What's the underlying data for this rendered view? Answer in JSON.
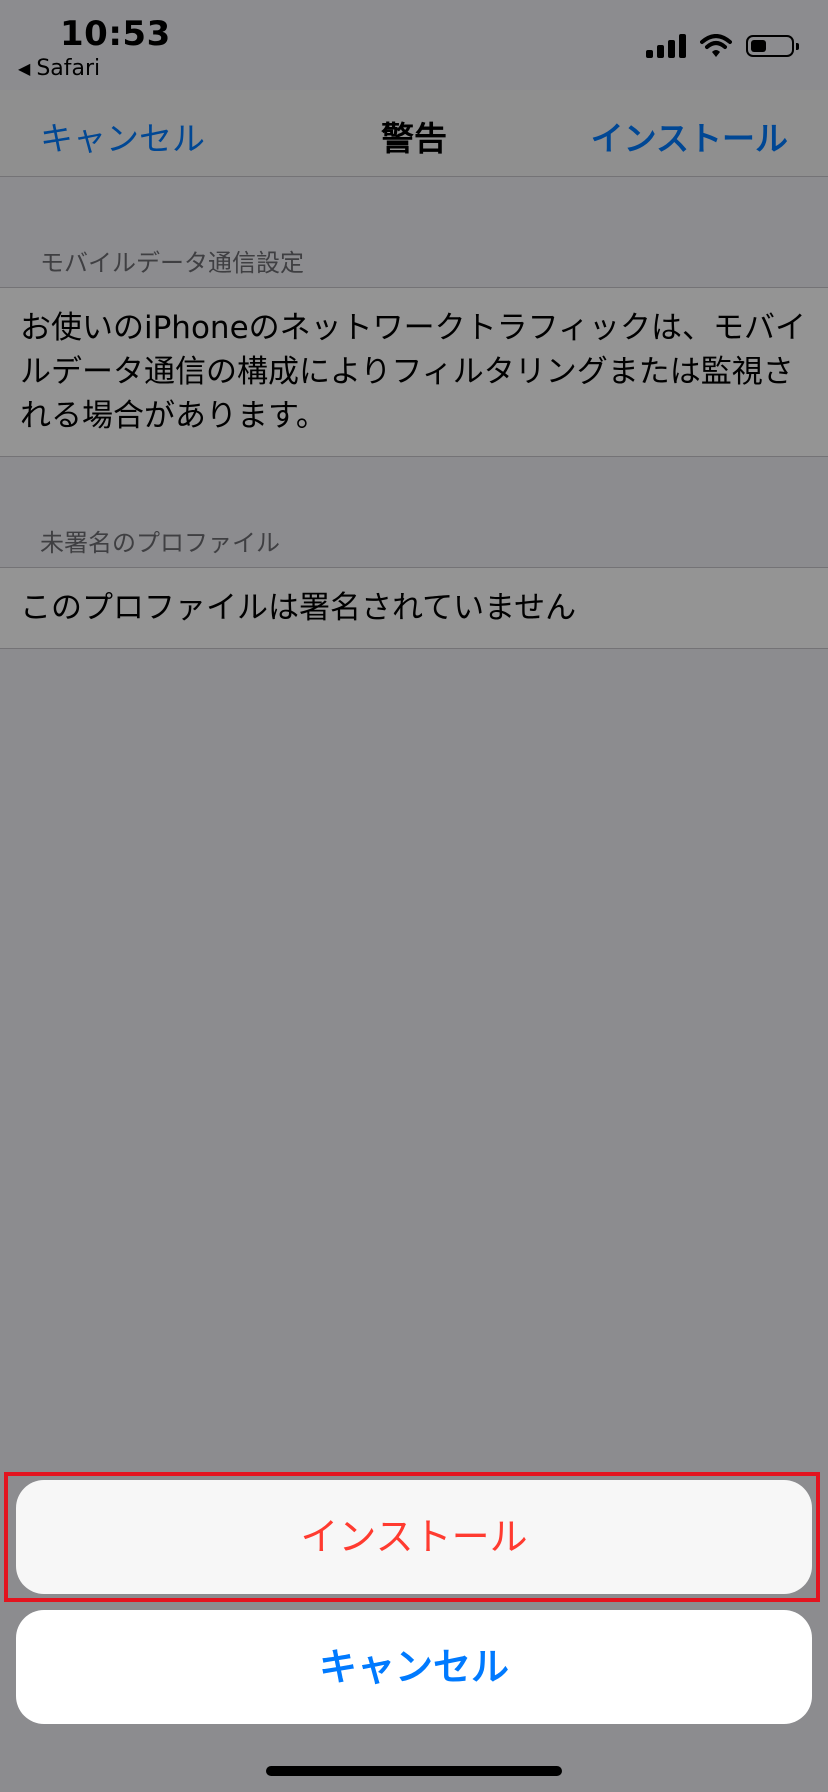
{
  "status_bar": {
    "time": "10:53",
    "back_app": "Safari",
    "icons": [
      "cellular-signal-icon",
      "wifi-icon",
      "battery-icon"
    ],
    "battery_level": 0.4
  },
  "nav": {
    "cancel_label": "キャンセル",
    "title": "警告",
    "install_label": "インストール"
  },
  "sections": [
    {
      "header": "モバイルデータ通信設定",
      "body": "お使いのiPhoneのネットワークトラフィックは、モバイルデータ通信の構成によりフィルタリングまたは監視される場合があります。"
    },
    {
      "header": "未署名のプロファイル",
      "body": "このプロファイルは署名されていません"
    }
  ],
  "action_sheet": {
    "install_label": "インストール",
    "cancel_label": "キャンセル"
  },
  "colors": {
    "accent": "#007aff",
    "destructive": "#ff3b30",
    "highlight_box": "#e3141f"
  }
}
